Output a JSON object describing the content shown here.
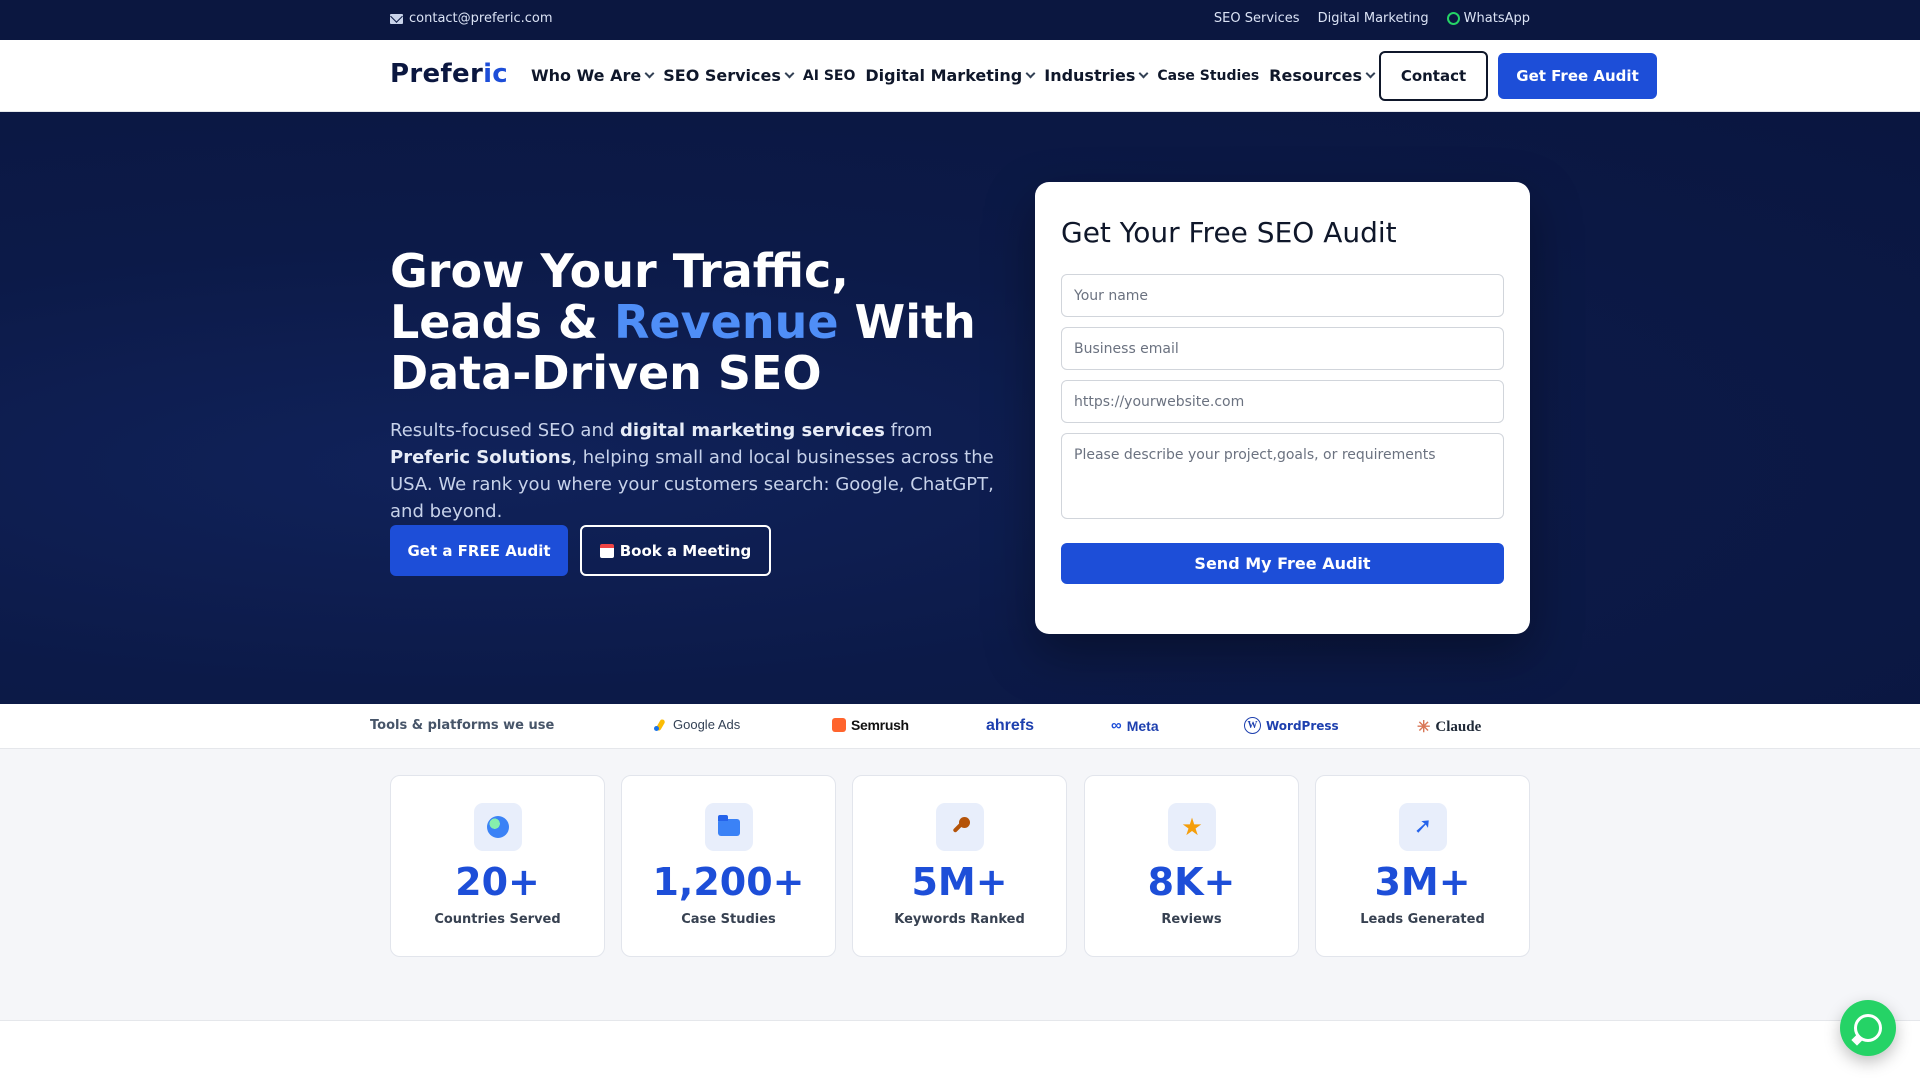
{
  "topbar": {
    "email": "contact@preferic.com",
    "links": [
      "SEO Services",
      "Digital Marketing",
      "WhatsApp"
    ]
  },
  "nav": {
    "logo_main": "Prefer",
    "logo_accent": "ic",
    "items": [
      {
        "label": "Who We Are",
        "dropdown": true
      },
      {
        "label": "SEO Services",
        "dropdown": true
      },
      {
        "label": "AI SEO",
        "dropdown": false
      },
      {
        "label": "Digital Marketing",
        "dropdown": true
      },
      {
        "label": "Industries",
        "dropdown": true
      },
      {
        "label": "Case Studies",
        "dropdown": false
      },
      {
        "label": "Resources",
        "dropdown": true
      }
    ],
    "contact_label": "Contact",
    "audit_label": "Get Free Audit"
  },
  "hero": {
    "title_part1": "Grow Your Traffic, Leads & ",
    "title_highlight": "Revenue",
    "title_part2": " With Data-Driven SEO",
    "desc_1": "Results-focused SEO and ",
    "desc_b1": "digital marketing services",
    "desc_2": " from ",
    "desc_b2": "Preferic Solutions",
    "desc_3": ", helping small and local businesses across the USA. We rank you where your customers search: Google, ChatGPT, and beyond.",
    "btn_primary": "Get a FREE Audit",
    "btn_secondary": "Book a Meeting"
  },
  "form": {
    "title": "Get Your Free SEO Audit",
    "name_placeholder": "Your name",
    "email_placeholder": "Business email",
    "url_placeholder": "https://yourwebsite.com",
    "message_placeholder": "Please describe your project,goals, or requirements",
    "submit_label": "Send My Free Audit"
  },
  "tools": {
    "label": "Tools & platforms we use",
    "items": [
      "Google Ads",
      "Semrush",
      "ahrefs",
      "Meta",
      "WordPress",
      "Claude"
    ]
  },
  "stats": [
    {
      "value": "20+",
      "label": "Countries Served",
      "icon": "globe-icon"
    },
    {
      "value": "1,200+",
      "label": "Case Studies",
      "icon": "folder-icon"
    },
    {
      "value": "5M+",
      "label": "Keywords Ranked",
      "icon": "key-icon"
    },
    {
      "value": "8K+",
      "label": "Reviews",
      "icon": "star-icon"
    },
    {
      "value": "3M+",
      "label": "Leads Generated",
      "icon": "rocket-icon"
    }
  ],
  "colors": {
    "brand_blue": "#1d4ed8",
    "navy": "#0b1740",
    "highlight": "#4f8ef7",
    "whatsapp": "#25d366"
  }
}
